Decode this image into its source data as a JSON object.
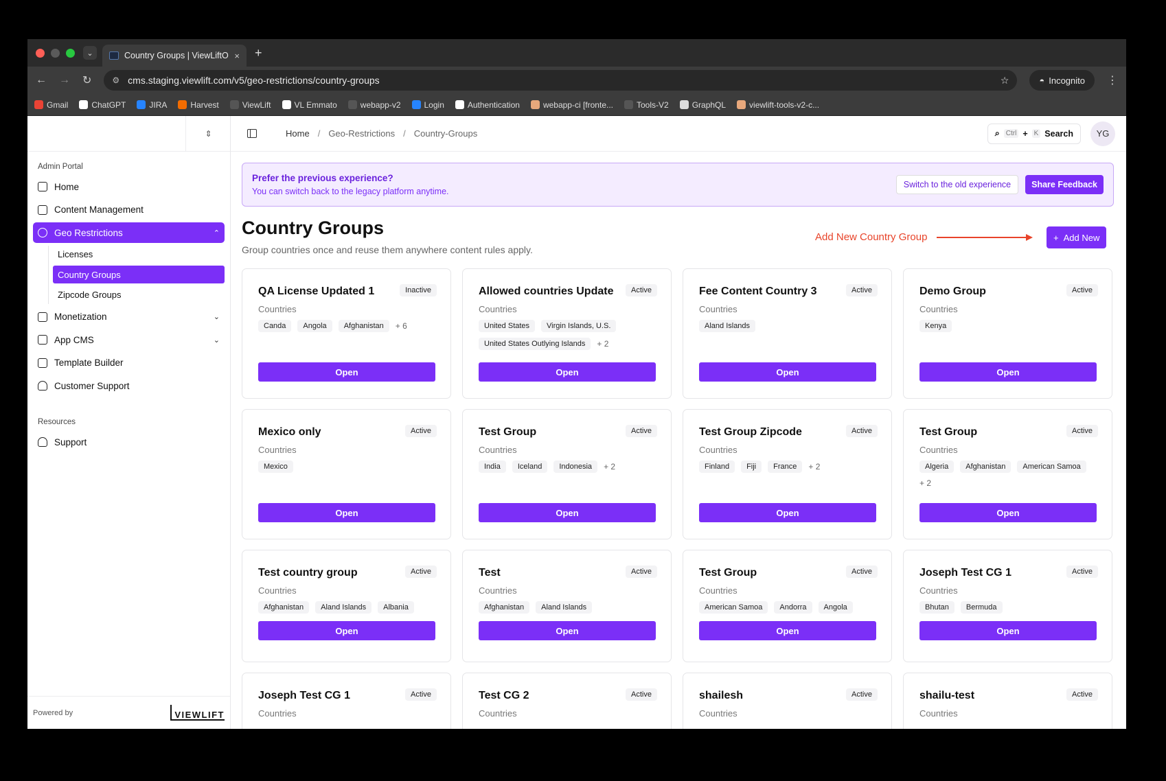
{
  "browser": {
    "tab_title": "Country Groups | ViewLiftOne",
    "tab_close": "×",
    "new_tab": "+",
    "url": "cms.staging.viewlift.com/v5/geo-restrictions/country-groups",
    "incognito": "Incognito",
    "bookmarks": [
      {
        "label": "Gmail",
        "color": "#ea4335"
      },
      {
        "label": "ChatGPT",
        "color": "#ffffff"
      },
      {
        "label": "JIRA",
        "color": "#2684ff"
      },
      {
        "label": "Harvest",
        "color": "#f36c00"
      },
      {
        "label": "ViewLift",
        "color": "#555555"
      },
      {
        "label": "VL Emmato",
        "color": "#ffffff"
      },
      {
        "label": "webapp-v2",
        "color": "#555555"
      },
      {
        "label": "Login",
        "color": "#2684ff"
      },
      {
        "label": "Authentication",
        "color": "#ffffff"
      },
      {
        "label": "webapp-ci [fronte...",
        "color": "#e8a87c"
      },
      {
        "label": "Tools-V2",
        "color": "#555555"
      },
      {
        "label": "GraphQL",
        "color": "#dddddd"
      },
      {
        "label": "viewlift-tools-v2-c...",
        "color": "#e8a87c"
      }
    ]
  },
  "sidebar": {
    "section_admin": "Admin Portal",
    "items": [
      {
        "label": "Home"
      },
      {
        "label": "Content Management"
      },
      {
        "label": "Geo Restrictions"
      }
    ],
    "geo_sub": [
      "Licenses",
      "Country Groups",
      "Zipcode Groups"
    ],
    "items2": [
      {
        "label": "Monetization"
      },
      {
        "label": "App CMS"
      },
      {
        "label": "Template Builder"
      },
      {
        "label": "Customer Support"
      }
    ],
    "section_resources": "Resources",
    "support": "Support",
    "powered_by": "Powered by",
    "logo": "VIEWLIFT"
  },
  "topbar": {
    "breadcrumb": [
      "Home",
      "Geo-Restrictions",
      "Country-Groups"
    ],
    "search_kbd1": "Ctrl",
    "search_plus": "+",
    "search_kbd2": "K",
    "search_label": "Search",
    "avatar": "YG"
  },
  "banner": {
    "title": "Prefer the previous experience?",
    "subtitle": "You can switch back to the legacy platform anytime.",
    "switch_label": "Switch to the old experience",
    "feedback_label": "Share Feedback"
  },
  "page": {
    "title": "Country Groups",
    "subtitle": "Group countries once and reuse them anywhere content rules apply.",
    "annotation": "Add New Country Group",
    "add_new": "Add New",
    "countries_label": "Countries",
    "open_label": "Open"
  },
  "cards": [
    {
      "name": "QA License Updated 1",
      "status": "Inactive",
      "countries": [
        "Canda",
        "Angola",
        "Afghanistan"
      ],
      "more": "+ 6"
    },
    {
      "name": "Allowed countries Update",
      "status": "Active",
      "countries": [
        "United States",
        "Virgin Islands, U.S.",
        "United States Outlying Islands"
      ],
      "more": "+ 2"
    },
    {
      "name": "Fee Content Country 3",
      "status": "Active",
      "countries": [
        "Aland Islands"
      ],
      "more": ""
    },
    {
      "name": "Demo Group",
      "status": "Active",
      "countries": [
        "Kenya"
      ],
      "more": ""
    },
    {
      "name": "Mexico only",
      "status": "Active",
      "countries": [
        "Mexico"
      ],
      "more": ""
    },
    {
      "name": "Test Group",
      "status": "Active",
      "countries": [
        "India",
        "Iceland",
        "Indonesia"
      ],
      "more": "+ 2"
    },
    {
      "name": "Test Group Zipcode",
      "status": "Active",
      "countries": [
        "Finland",
        "Fiji",
        "France"
      ],
      "more": "+ 2"
    },
    {
      "name": "Test Group",
      "status": "Active",
      "countries": [
        "Algeria",
        "Afghanistan",
        "American Samoa"
      ],
      "more": "+ 2"
    },
    {
      "name": "Test country group",
      "status": "Active",
      "countries": [
        "Afghanistan",
        "Aland Islands",
        "Albania"
      ],
      "more": ""
    },
    {
      "name": "Test",
      "status": "Active",
      "countries": [
        "Afghanistan",
        "Aland Islands"
      ],
      "more": ""
    },
    {
      "name": "Test Group",
      "status": "Active",
      "countries": [
        "American Samoa",
        "Andorra",
        "Angola"
      ],
      "more": ""
    },
    {
      "name": "Joseph Test CG 1",
      "status": "Active",
      "countries": [
        "Bhutan",
        "Bermuda"
      ],
      "more": ""
    },
    {
      "name": "Joseph Test CG 1",
      "status": "Active",
      "countries": [],
      "more": ""
    },
    {
      "name": "Test CG 2",
      "status": "Active",
      "countries": [],
      "more": ""
    },
    {
      "name": "shailesh",
      "status": "Active",
      "countries": [],
      "more": ""
    },
    {
      "name": "shailu-test",
      "status": "Active",
      "countries": [],
      "more": ""
    }
  ]
}
